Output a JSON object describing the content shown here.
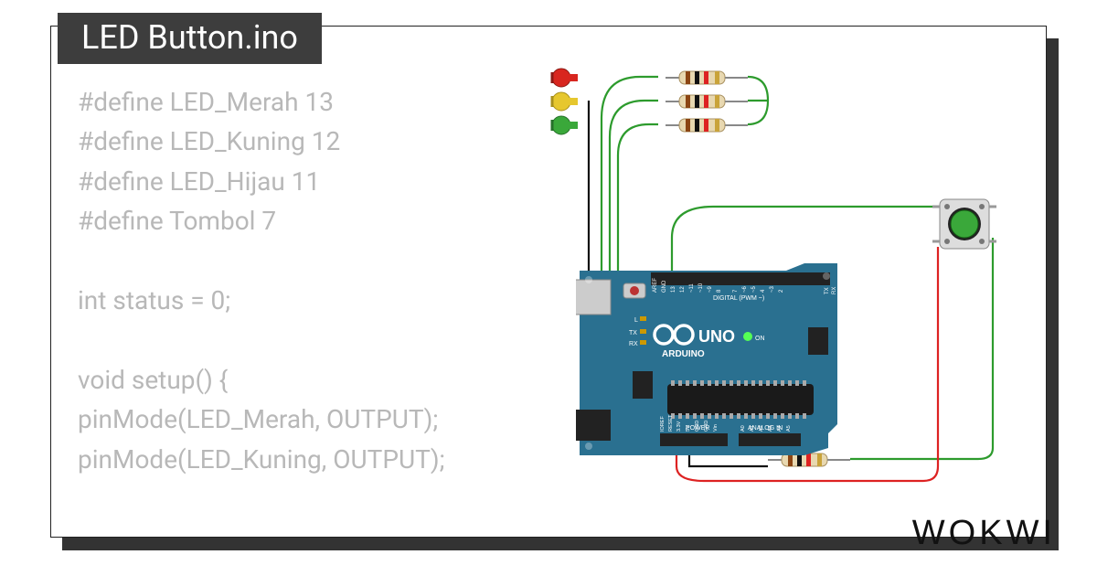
{
  "title": "LED Button.ino",
  "brand": "WOKWI",
  "code_lines": [
    "#define LED_Merah 13",
    "#define LED_Kuning 12",
    "#define LED_Hijau 11",
    "#define Tombol 7",
    "",
    "int status = 0;",
    "",
    "void setup() {",
    "pinMode(LED_Merah, OUTPUT);",
    "pinMode(LED_Kuning, OUTPUT);"
  ],
  "arduino": {
    "label_uno": "UNO",
    "label_brand": "ARDUINO",
    "label_digital": "DIGITAL (PWM ~)",
    "label_power": "POWER",
    "label_analog": "ANALOG IN",
    "label_tx": "TX",
    "label_rx": "RX",
    "label_l": "L",
    "label_on": "ON",
    "pins_digital": [
      "AREF",
      "GND",
      "13",
      "12",
      "~11",
      "~10",
      "~9",
      "8",
      "7",
      "~6",
      "~5",
      "4",
      "~3",
      "2",
      "TX 1",
      "RX 0"
    ],
    "pins_power": [
      "IOREF",
      "RESET",
      "3.3V",
      "5V",
      "GND",
      "GND",
      "Vin"
    ],
    "pins_analog": [
      "A0",
      "A1",
      "A2",
      "A3",
      "A4",
      "A5"
    ]
  },
  "components": {
    "leds": [
      {
        "name": "LED_Merah",
        "color": "#d8261f",
        "pin": 13
      },
      {
        "name": "LED_Kuning",
        "color": "#e6c72e",
        "pin": 12
      },
      {
        "name": "LED_Hijau",
        "color": "#3aa83a",
        "pin": 11
      }
    ],
    "button": {
      "name": "Tombol",
      "pin": 7,
      "color": "#3aa83a"
    },
    "resistors": 4
  }
}
